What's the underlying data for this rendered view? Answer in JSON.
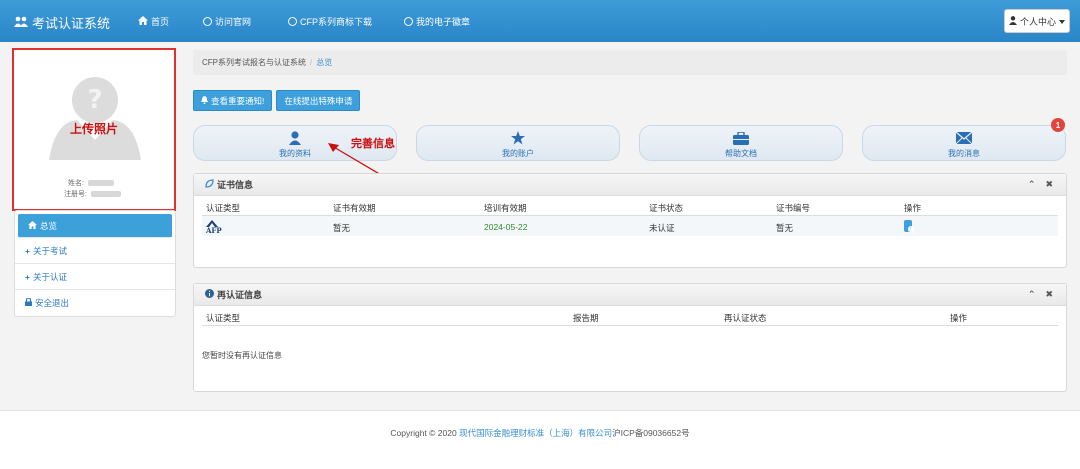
{
  "topbar": {
    "brand": "考试认证系统",
    "nav": [
      {
        "label": "首页"
      },
      {
        "label": "访问官网"
      },
      {
        "label": "CFP系列商标下载"
      },
      {
        "label": "我的电子徽章"
      }
    ],
    "user_menu": "个人中心"
  },
  "profile": {
    "upload_label": "上传照片",
    "name_label": "姓名:",
    "reg_label": "注册号:"
  },
  "sidebar": {
    "items": [
      {
        "label": "总览"
      },
      {
        "label": "关于考试"
      },
      {
        "label": "关于认证"
      },
      {
        "label": "安全退出"
      }
    ]
  },
  "breadcrumb": {
    "root": "CFP系列考试报名与认证系统",
    "sep": "/",
    "current": "总览"
  },
  "actions": {
    "notice_btn": "查看重要通知!",
    "apply_btn": "在线提出特殊申请"
  },
  "tiles": [
    {
      "label": "我的资料",
      "icon": "user-icon"
    },
    {
      "label": "我的账户",
      "icon": "star-icon"
    },
    {
      "label": "帮助文档",
      "icon": "briefcase-icon"
    },
    {
      "label": "我的消息",
      "icon": "envelope-icon",
      "badge": "1"
    }
  ],
  "annotation": "完善信息",
  "cert_panel": {
    "title": "证书信息",
    "columns": [
      "认证类型",
      "证书有效期",
      "培训有效期",
      "证书状态",
      "证书编号",
      "操作"
    ],
    "row": {
      "type_logo": "AFP",
      "cert_valid": "暂无",
      "train_valid": "2024-05-22",
      "status": "未认证",
      "number": "暂无",
      "action": "考试报名"
    }
  },
  "recert_panel": {
    "title": "再认证信息",
    "columns": [
      "认证类型",
      "报告期",
      "再认证状态",
      "操作"
    ],
    "empty": "您暂时没有再认证信息"
  },
  "footer": {
    "prefix": "Copyright © 2020 ",
    "company": "现代国际金融理财标准（上海）有限公司",
    "icp": "沪ICP备09036652号"
  },
  "colors": {
    "topbar": "#2a86c8",
    "accent": "#3d9fdb",
    "annotation": "#cc1010",
    "badge": "#e0443b"
  }
}
